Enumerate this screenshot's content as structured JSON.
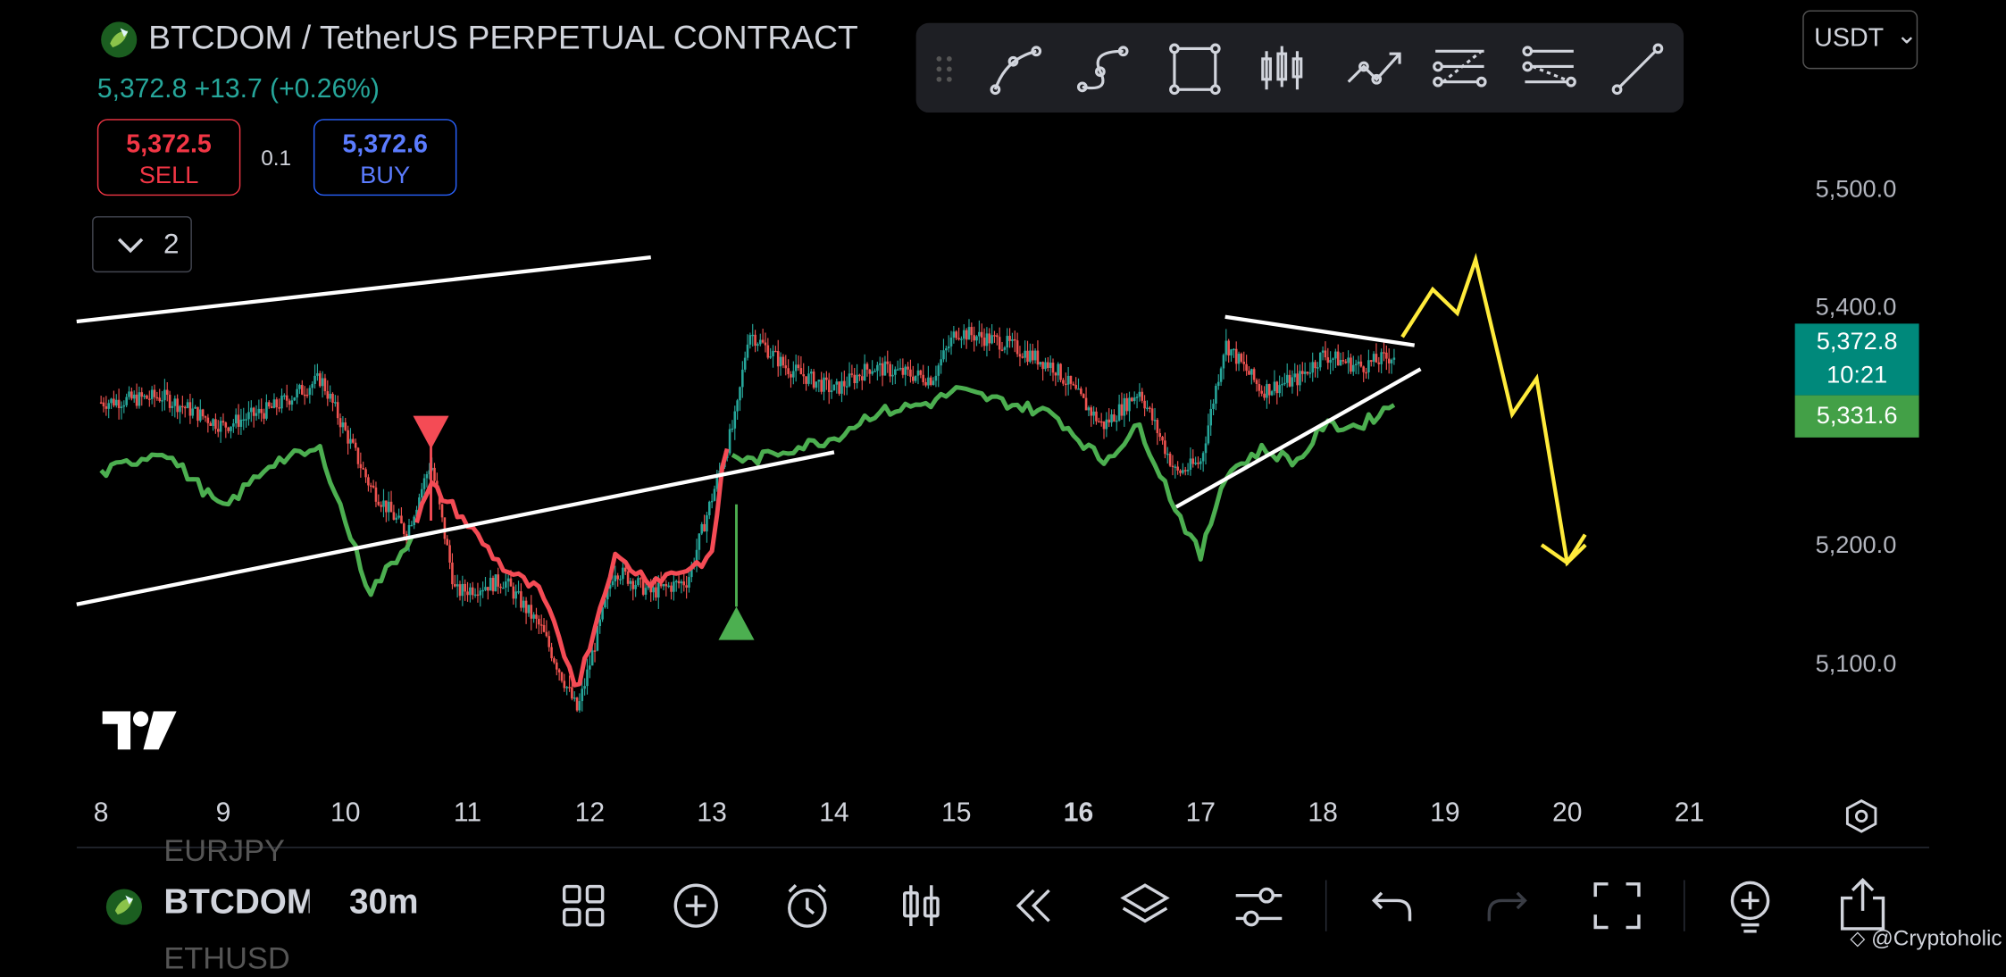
{
  "header": {
    "title": "BTCDOM / TetherUS PERPETUAL CONTRACT",
    "price_change": "5,372.8  +13.7 (+0.26%)",
    "currency": "USDT",
    "currency_chevron": "⌄"
  },
  "trade": {
    "sell_price": "5,372.5",
    "sell_label": "SELL",
    "quantity": "0.1",
    "buy_price": "5,372.6",
    "buy_label": "BUY"
  },
  "indicators": {
    "collapsed_count": "2"
  },
  "drawing_tools": [
    "drag-handle",
    "curve-tool",
    "path-tool",
    "rectangle-tool",
    "candles-tool",
    "polyline-arrow-tool",
    "fib-retracement-tool",
    "fib-extension-tool",
    "trend-line-tool"
  ],
  "price_axis": {
    "labels": [
      "5,500.0",
      "5,400.0",
      "5,200.0",
      "5,100.0"
    ],
    "current_price": "5,372.8",
    "countdown": "10:21",
    "indicator_value": "5,331.6"
  },
  "time_axis": {
    "labels": [
      "8",
      "9",
      "10",
      "11",
      "12",
      "13",
      "14",
      "15",
      "16",
      "17",
      "18",
      "19",
      "20",
      "21"
    ],
    "bold_label": "16"
  },
  "bottom_bar": {
    "symbol": "BTCDOM",
    "interval": "30m",
    "ghost_top": "EURJPY",
    "ghost_bottom": "ETHUSD"
  },
  "watermark": "@Cryptoholic",
  "colors": {
    "up": "#26a69a",
    "down": "#ef5350",
    "indicator_bull": "#4caf50",
    "indicator_bear": "#f44b55",
    "projection": "#ffeb3b",
    "trendline": "#ffffff",
    "sell": "#f23645",
    "buy": "#2962ff"
  },
  "chart_data": {
    "type": "candlestick",
    "interval": "30m",
    "price_axis_ticks": [
      5500,
      5400,
      5200,
      5100
    ],
    "x_ticks": [
      "8",
      "9",
      "10",
      "11",
      "12",
      "13",
      "14",
      "15",
      "16",
      "17",
      "18",
      "19",
      "20",
      "21"
    ],
    "current_price": 5372.8,
    "indicator_value": 5331.6,
    "price_path": [
      [
        8,
        5320
      ],
      [
        8.5,
        5325
      ],
      [
        9,
        5300
      ],
      [
        9.4,
        5315
      ],
      [
        9.8,
        5340
      ],
      [
        10.2,
        5250
      ],
      [
        10.5,
        5210
      ],
      [
        10.7,
        5270
      ],
      [
        10.9,
        5160
      ],
      [
        11.3,
        5170
      ],
      [
        11.6,
        5130
      ],
      [
        11.9,
        5060
      ],
      [
        12.2,
        5180
      ],
      [
        12.5,
        5160
      ],
      [
        12.8,
        5170
      ],
      [
        13.0,
        5240
      ],
      [
        13.2,
        5310
      ],
      [
        13.3,
        5380
      ],
      [
        13.6,
        5350
      ],
      [
        14.0,
        5330
      ],
      [
        14.3,
        5350
      ],
      [
        14.8,
        5340
      ],
      [
        15.0,
        5380
      ],
      [
        15.4,
        5370
      ],
      [
        15.8,
        5350
      ],
      [
        16.2,
        5300
      ],
      [
        16.5,
        5330
      ],
      [
        16.8,
        5260
      ],
      [
        17.0,
        5270
      ],
      [
        17.2,
        5370
      ],
      [
        17.5,
        5330
      ],
      [
        17.8,
        5340
      ],
      [
        18.0,
        5360
      ],
      [
        18.3,
        5350
      ],
      [
        18.6,
        5360
      ]
    ],
    "indicator_path": [
      [
        8,
        5260
      ],
      [
        8.5,
        5280
      ],
      [
        9,
        5230
      ],
      [
        9.4,
        5270
      ],
      [
        9.8,
        5280
      ],
      [
        10.2,
        5160
      ],
      [
        10.5,
        5200
      ],
      [
        10.7,
        5250
      ],
      [
        10.9,
        5230
      ],
      [
        11.3,
        5180
      ],
      [
        11.6,
        5160
      ],
      [
        11.9,
        5080
      ],
      [
        12.2,
        5190
      ],
      [
        12.5,
        5170
      ],
      [
        12.8,
        5180
      ],
      [
        13.0,
        5190
      ],
      [
        13.1,
        5280
      ],
      [
        13.3,
        5270
      ],
      [
        13.6,
        5280
      ],
      [
        14.0,
        5290
      ],
      [
        14.3,
        5310
      ],
      [
        14.8,
        5320
      ],
      [
        15.0,
        5330
      ],
      [
        15.4,
        5320
      ],
      [
        15.8,
        5310
      ],
      [
        16.2,
        5270
      ],
      [
        16.5,
        5300
      ],
      [
        16.8,
        5230
      ],
      [
        17.0,
        5190
      ],
      [
        17.2,
        5260
      ],
      [
        17.5,
        5280
      ],
      [
        17.8,
        5270
      ],
      [
        18.0,
        5300
      ],
      [
        18.3,
        5300
      ],
      [
        18.6,
        5320
      ]
    ],
    "signals": [
      {
        "type": "sell",
        "x": 10.7,
        "y": 5285
      },
      {
        "type": "buy",
        "x": 13.2,
        "y": 5148
      }
    ],
    "projection_path": [
      [
        18.65,
        5375
      ],
      [
        18.9,
        5415
      ],
      [
        19.1,
        5395
      ],
      [
        19.25,
        5440
      ],
      [
        19.55,
        5310
      ],
      [
        19.75,
        5340
      ],
      [
        20.0,
        5185
      ],
      [
        20.15,
        5200
      ]
    ],
    "trendlines": [
      {
        "from": [
          7.8,
          5388
        ],
        "to": [
          12.5,
          5442
        ]
      },
      {
        "from": [
          7.8,
          5150
        ],
        "to": [
          14.0,
          5278
        ]
      },
      {
        "from": [
          17.2,
          5392
        ],
        "to": [
          18.75,
          5368
        ]
      },
      {
        "from": [
          16.8,
          5232
        ],
        "to": [
          18.8,
          5348
        ]
      }
    ],
    "legend": "none",
    "grid": false
  }
}
